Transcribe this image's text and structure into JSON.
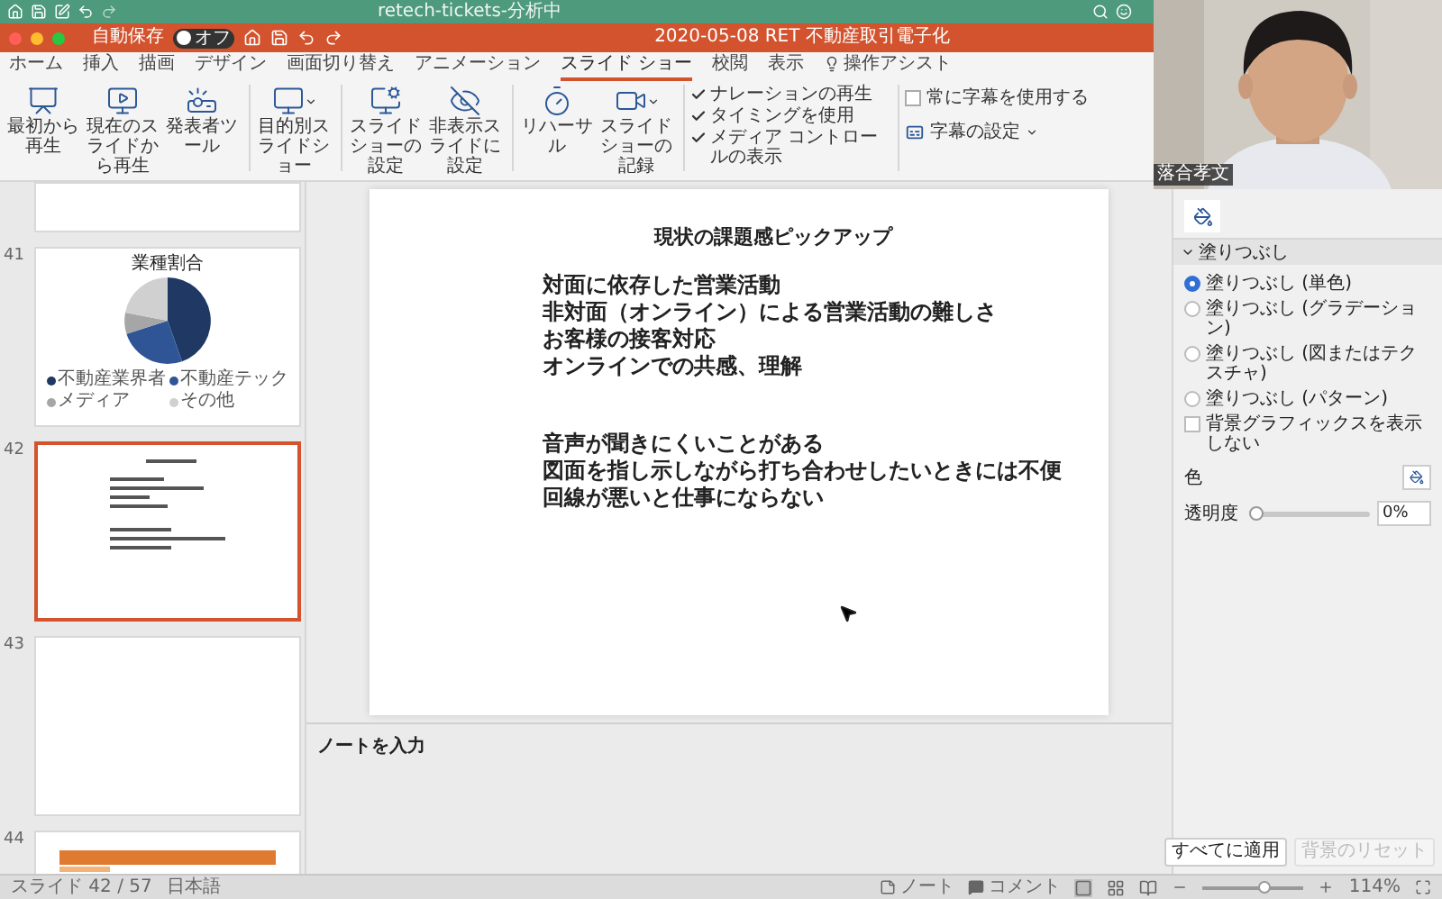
{
  "title_bar": {
    "title": "retech-tickets-分析中"
  },
  "document_bar": {
    "autosave_label": "自動保存",
    "autosave_state": "オフ",
    "autosave_on": false,
    "title": "2020-05-08 RET 不動産取引電子化"
  },
  "tabs": [
    {
      "label": "ホーム",
      "selected": false
    },
    {
      "label": "挿入",
      "selected": false
    },
    {
      "label": "描画",
      "selected": false
    },
    {
      "label": "デザイン",
      "selected": false
    },
    {
      "label": "画面切り替え",
      "selected": false
    },
    {
      "label": "アニメーション",
      "selected": false
    },
    {
      "label": "スライド ショー",
      "selected": true
    },
    {
      "label": "校閲",
      "selected": false
    },
    {
      "label": "表示",
      "selected": false
    },
    {
      "label": "操作アシスト",
      "selected": false
    }
  ],
  "ribbon": {
    "buttons": [
      "最初から再生",
      "現在のスライドから再生",
      "発表者ツール",
      "目的別スライドショー",
      "スライドショーの設定",
      "非表示スライドに設定",
      "リハーサル",
      "スライドショーの記録"
    ],
    "options": [
      {
        "label": "ナレーションの再生",
        "checked": true
      },
      {
        "label": "タイミングを使用",
        "checked": true
      },
      {
        "label": "メディア コントロールの表示",
        "checked": true
      }
    ],
    "captions": [
      {
        "kind": "checkbox",
        "label": "常に字幕を使用する",
        "checked": false
      },
      {
        "kind": "menu",
        "label": "字幕の設定"
      }
    ]
  },
  "slides_panel": {
    "slides": [
      {
        "kind": "blank",
        "selected": false
      },
      {
        "number": "41",
        "kind": "chart",
        "selected": false,
        "title": "業種割合",
        "legend": [
          {
            "label": "不動産業界者",
            "color": "#1f3864"
          },
          {
            "label": "不動産テック",
            "color": "#2f5597"
          },
          {
            "label": "メディア",
            "color": "#a6a6a6"
          },
          {
            "label": "その他",
            "color": "#d0d0d0"
          }
        ]
      },
      {
        "number": "42",
        "kind": "text",
        "selected": true
      },
      {
        "number": "43",
        "kind": "blank",
        "selected": false
      },
      {
        "number": "44",
        "kind": "banner",
        "selected": false
      }
    ]
  },
  "slide": {
    "title": "現状の課題感ピックアップ",
    "groups": [
      {
        "lines": [
          "対面に依存した営業活動",
          "非対面（オンライン）による営業活動の難しさ",
          "お客様の接客対応",
          "オンラインでの共感、理解"
        ]
      },
      {
        "lines": [
          "音声が聞きにくいことがある",
          "図面を指し示しながら打ち合わせしたいときには不便",
          "回線が悪いと仕事にならない"
        ]
      }
    ]
  },
  "notes": {
    "placeholder": "ノートを入力"
  },
  "format_pane": {
    "section": "塗りつぶし",
    "expanded": true,
    "fill_options": [
      {
        "label": "塗りつぶし (単色)",
        "selected": true
      },
      {
        "label": "塗りつぶし (グラデーション)",
        "selected": false
      },
      {
        "label": "塗りつぶし (図またはテクスチャ)",
        "selected": false
      },
      {
        "label": "塗りつぶし (パターン)",
        "selected": false
      }
    ],
    "hide_background": {
      "label": "背景グラフィックスを表示しない",
      "checked": false
    },
    "color_label": "色",
    "transparency": {
      "label": "透明度",
      "level": 0,
      "reading": "0%"
    },
    "buttons": [
      {
        "label": "すべてに適用",
        "disabled": false
      },
      {
        "label": "背景のリセット",
        "disabled": true
      }
    ]
  },
  "status_bar": {
    "slide": "スライド 42 / 57",
    "language": "日本語",
    "notes": "ノート",
    "comments": "コメント",
    "zoom": {
      "level": 0.6,
      "reading": "114%"
    }
  },
  "webcam": {
    "name": "落合孝文"
  }
}
